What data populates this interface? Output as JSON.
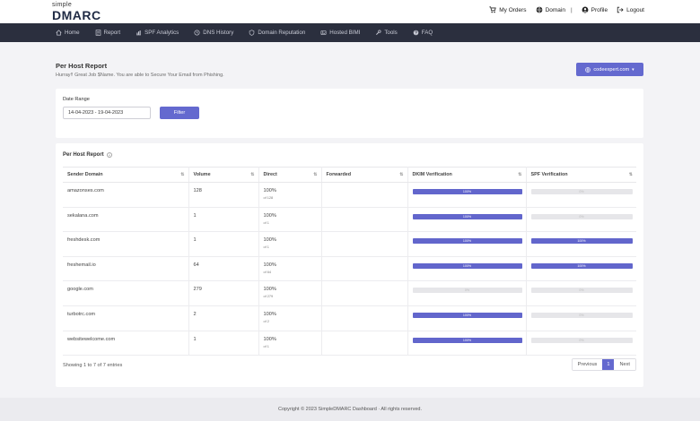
{
  "logo": {
    "small": "simple",
    "big": "DMARC"
  },
  "top_links": [
    {
      "label": "My Orders",
      "icon": "cart-icon"
    },
    {
      "label": "Domain",
      "icon": "globe-icon"
    },
    {
      "label": "Profile",
      "icon": "user-icon"
    },
    {
      "label": "Logout",
      "icon": "logout-icon"
    }
  ],
  "top_separator": "|",
  "nav": [
    {
      "label": "Home",
      "icon": "home-icon"
    },
    {
      "label": "Report",
      "icon": "report-icon"
    },
    {
      "label": "SPF Analytics",
      "icon": "analytics-icon"
    },
    {
      "label": "DNS History",
      "icon": "history-icon"
    },
    {
      "label": "Domain Reputation",
      "icon": "reputation-icon"
    },
    {
      "label": "Hosted BIMI",
      "icon": "bimi-icon"
    },
    {
      "label": "Tools",
      "icon": "tools-icon"
    },
    {
      "label": "FAQ",
      "icon": "faq-icon"
    }
  ],
  "page": {
    "title": "Per Host Report",
    "subtitle": "Hurray!! Great Job $Name. You are able to Secure Your Email from Phishing.",
    "domain_button": "codeexpert.com"
  },
  "filter": {
    "label": "Date Range",
    "date_value": "14-04-2023 - 19-04-2023",
    "button": "Filter"
  },
  "report": {
    "title": "Per Host Report",
    "columns": [
      "Sender Domain",
      "Volume",
      "Direct",
      "Forwarded",
      "DKIM Verification",
      "SPF Verification"
    ],
    "rows": [
      {
        "domain": "amazonses.com",
        "volume": "128",
        "direct": "100%",
        "direct_sub": "of 128",
        "forwarded": "",
        "dkim": 100,
        "dkim_label": "100%",
        "spf": 0,
        "spf_label": "0%"
      },
      {
        "domain": "sekalana.com",
        "volume": "1",
        "direct": "100%",
        "direct_sub": "of 1",
        "forwarded": "",
        "dkim": 100,
        "dkim_label": "100%",
        "spf": 0,
        "spf_label": "0%"
      },
      {
        "domain": "freshdesk.com",
        "volume": "1",
        "direct": "100%",
        "direct_sub": "of 1",
        "forwarded": "",
        "dkim": 100,
        "dkim_label": "100%",
        "spf": 100,
        "spf_label": "100%"
      },
      {
        "domain": "freshemail.io",
        "volume": "64",
        "direct": "100%",
        "direct_sub": "of 64",
        "forwarded": "",
        "dkim": 100,
        "dkim_label": "100%",
        "spf": 100,
        "spf_label": "100%"
      },
      {
        "domain": "google.com",
        "volume": "279",
        "direct": "100%",
        "direct_sub": "of 279",
        "forwarded": "",
        "dkim": 0,
        "dkim_label": "0%",
        "spf": 0,
        "spf_label": "0%"
      },
      {
        "domain": "turbotrc.com",
        "volume": "2",
        "direct": "100%",
        "direct_sub": "of 2",
        "forwarded": "",
        "dkim": 100,
        "dkim_label": "100%",
        "spf": 0,
        "spf_label": "0%"
      },
      {
        "domain": "websitewelcome.com",
        "volume": "1",
        "direct": "100%",
        "direct_sub": "of 1",
        "forwarded": "",
        "dkim": 100,
        "dkim_label": "100%",
        "spf": 0,
        "spf_label": "0%"
      }
    ],
    "showing": "Showing 1 to 7 of 7 entries",
    "pagination": {
      "previous": "Previous",
      "current": "1",
      "next": "Next"
    }
  },
  "footer": "Copyright © 2023 SimpleDMARC Dashboard · All rights reserved.",
  "colors": {
    "accent": "#6469cf",
    "nav_bg": "#2b2f3e",
    "bar_fill": "#6266cc",
    "bar_empty": "#e6e6e9"
  }
}
